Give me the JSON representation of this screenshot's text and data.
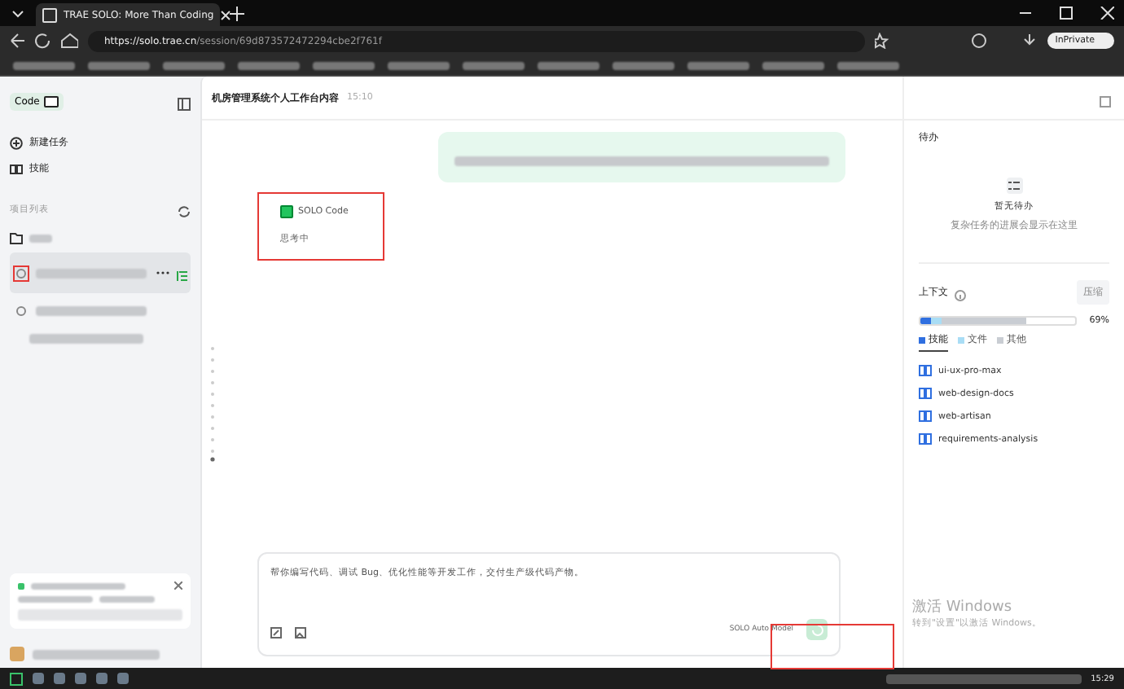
{
  "browser": {
    "tab_title": "TRAE SOLO: More Than Coding",
    "url_host": "https://solo.trae.cn",
    "url_path": "/session/69d873572472294cbe2f761f",
    "profile_label": "InPrivate"
  },
  "sidebar": {
    "mode_label": "Code",
    "nav": [
      {
        "label": "新建任务",
        "kind": "new"
      },
      {
        "label": "技能",
        "kind": "skills"
      }
    ],
    "section_title": "项目列表",
    "sessions": [
      {
        "selected": true,
        "annotated": true
      },
      {
        "selected": false,
        "annotated": false
      }
    ]
  },
  "conversation": {
    "title": "机房管理系统个人工作台内容",
    "time": "15:10",
    "agent_name": "SOLO Code",
    "agent_status": "思考中",
    "input_placeholder": "帮你编写代码、调试 Bug、优化性能等开发工作，交付生产级代码产物。",
    "model": "SOLO Auto Model"
  },
  "todo": {
    "title": "待办",
    "empty_title": "暂无待办",
    "empty_hint": "复杂任务的进展会显示在这里"
  },
  "context": {
    "title": "上下文",
    "compress_button": "压缩",
    "level": 0.69,
    "reading": "69%",
    "segments": [
      {
        "label": "技能",
        "color": "#2f6fe0",
        "selected": true
      },
      {
        "label": "文件",
        "color": "#a9ddf5",
        "selected": false
      },
      {
        "label": "其他",
        "color": "#c9cdd3",
        "selected": false
      }
    ],
    "skills": [
      "ui-ux-pro-max",
      "web-design-docs",
      "web-artisan",
      "requirements-analysis"
    ]
  },
  "os": {
    "clock": "15:29",
    "activation_title": "激活 Windows",
    "activation_hint": "转到\"设置\"以激活 Windows。"
  }
}
